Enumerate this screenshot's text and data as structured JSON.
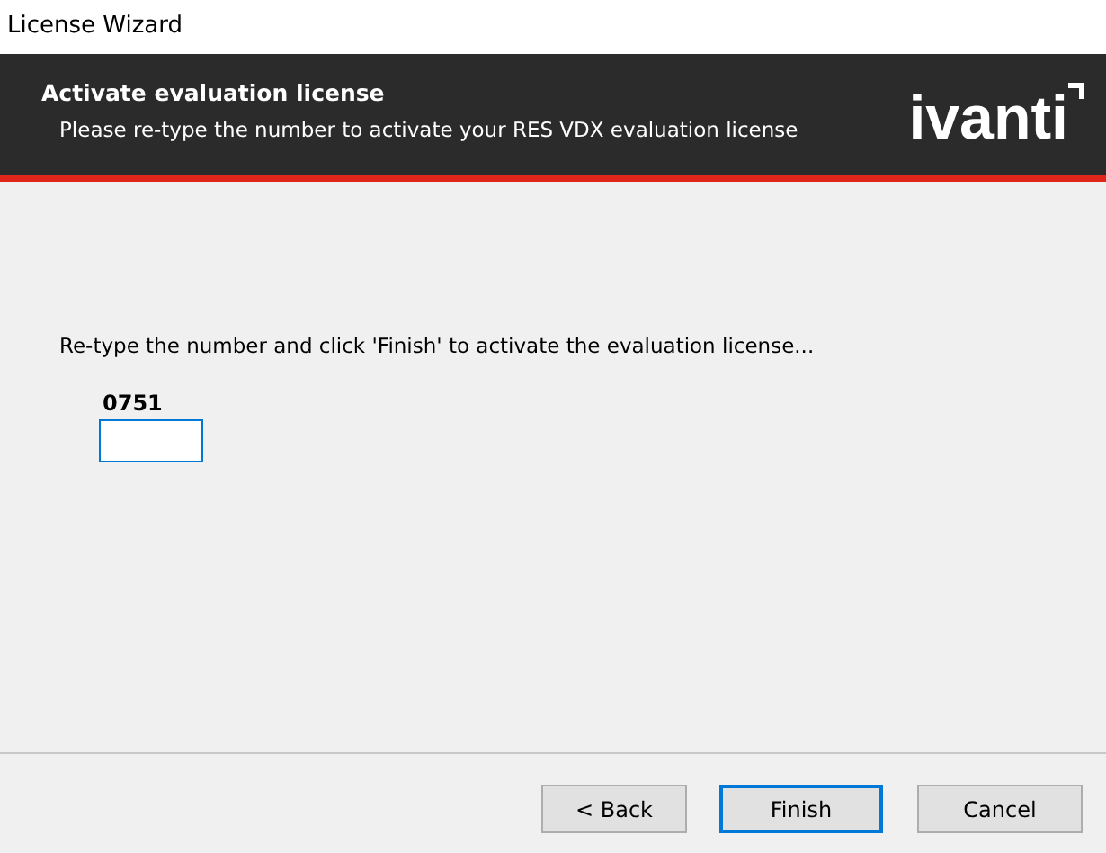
{
  "window": {
    "title": "License Wizard"
  },
  "header": {
    "title": "Activate evaluation license",
    "subtitle": "Please re-type the number to activate your RES VDX evaluation license",
    "logo": "ivanti"
  },
  "instruction": "Re-type the number and click 'Finish' to activate the evaluation license...",
  "code": {
    "label": "0751"
  },
  "buttons": [
    {
      "label": "< Back",
      "default": false
    },
    {
      "label": "Finish",
      "default": true
    },
    {
      "label": "Cancel",
      "default": false
    }
  ]
}
